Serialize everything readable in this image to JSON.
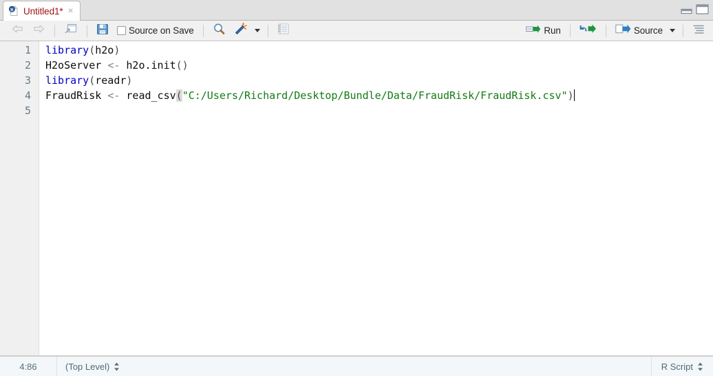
{
  "tab": {
    "title": "Untitled1*",
    "close_label": "×",
    "icon": "r-script-file-icon"
  },
  "window_controls": {
    "minimize": "minimize-pane-icon",
    "maximize": "maximize-pane-icon"
  },
  "toolbar": {
    "back_icon": "back-arrow-icon",
    "forward_icon": "forward-arrow-icon",
    "popout_icon": "show-in-new-window-icon",
    "save_icon": "save-floppy-icon",
    "source_on_save_label": "Source on Save",
    "find_icon": "search-magnifier-icon",
    "code_tools_icon": "magic-wand-icon",
    "compile_report_icon": "compile-notebook-icon",
    "run_label": "Run",
    "run_icon": "run-arrow-icon",
    "rerun_icon": "rerun-loop-icon",
    "source_label": "Source",
    "source_icon": "source-arrow-icon",
    "outline_icon": "document-outline-icon"
  },
  "editor": {
    "gutter": [
      "1",
      "2",
      "3",
      "4",
      "5"
    ],
    "lines": [
      {
        "n": 1,
        "tokens": [
          {
            "t": "library",
            "c": "kw"
          },
          {
            "t": "(",
            "c": "paren"
          },
          {
            "t": "h2o",
            "c": "ident"
          },
          {
            "t": ")",
            "c": "paren"
          }
        ]
      },
      {
        "n": 2,
        "tokens": [
          {
            "t": "H2oServer ",
            "c": "ident"
          },
          {
            "t": "<-",
            "c": "assign"
          },
          {
            "t": " h2o.init",
            "c": "ident"
          },
          {
            "t": "()",
            "c": "paren"
          }
        ]
      },
      {
        "n": 3,
        "tokens": [
          {
            "t": "library",
            "c": "kw"
          },
          {
            "t": "(",
            "c": "paren"
          },
          {
            "t": "readr",
            "c": "ident"
          },
          {
            "t": ")",
            "c": "paren"
          }
        ]
      },
      {
        "n": 4,
        "tokens": [
          {
            "t": "FraudRisk ",
            "c": "ident"
          },
          {
            "t": "<-",
            "c": "assign"
          },
          {
            "t": " read_csv",
            "c": "ident"
          },
          {
            "t": "(",
            "c": "paren-hl"
          },
          {
            "t": "\"C:/Users/Richard/Desktop/Bundle/Data/FraudRisk/FraudRisk.csv\"",
            "c": "str"
          },
          {
            "t": ")",
            "c": "paren"
          }
        ],
        "cursor_after": true
      },
      {
        "n": 5,
        "tokens": []
      }
    ],
    "plain_text": "library(h2o)\nH2oServer <- h2o.init()\nlibrary(readr)\nFraudRisk <- read_csv(\"C:/Users/Richard/Desktop/Bundle/Data/FraudRisk/FraudRisk.csv\")\n"
  },
  "statusbar": {
    "cursor_position": "4:86",
    "scope": "(Top Level)",
    "doc_type": "R Script"
  },
  "colors": {
    "keyword": "#0000c0",
    "string": "#137a13",
    "assign": "#7f7f7f",
    "tab_title": "#a01419",
    "status_text": "#4c6a7b",
    "gutter_bg": "#f0f0f0",
    "toolbar_bg": "#f1f1f1",
    "statusbar_bg": "#f4f7f9",
    "run_green": "#1e9641",
    "save_blue": "#4a90c4"
  }
}
